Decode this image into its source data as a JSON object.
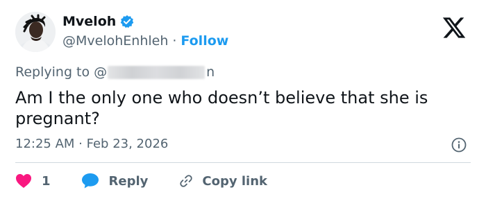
{
  "author": {
    "display_name": "Mveloh",
    "handle": "@MvelohEnhleh",
    "separator": "·",
    "follow_label": "Follow",
    "verified": true
  },
  "reply": {
    "prefix": "Replying to @",
    "suffix": "n"
  },
  "tweet": {
    "text": "Am I the only one who doesn’t believe that she is pregnant?",
    "timestamp": "12:25 AM · Feb 23, 2026"
  },
  "actions": {
    "like_count": "1",
    "reply_label": "Reply",
    "copy_label": "Copy link"
  },
  "colors": {
    "accent": "#1d9bf0",
    "like": "#f91880",
    "text": "#0f1419",
    "muted": "#536471"
  },
  "icons": [
    "verified-badge-icon",
    "x-logo-icon",
    "info-icon",
    "heart-icon",
    "speech-bubble-icon",
    "link-icon"
  ]
}
